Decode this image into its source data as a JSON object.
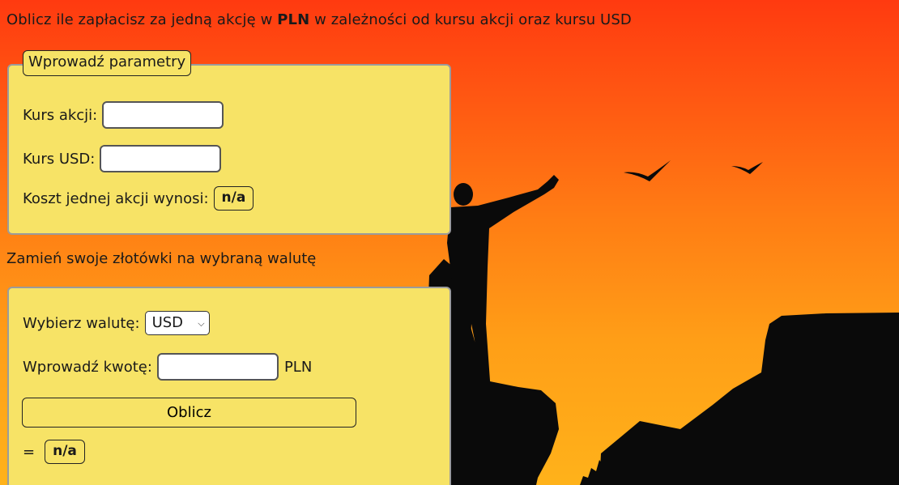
{
  "header": {
    "text_before": "Oblicz ile zapłacisz za jedną akcję w ",
    "text_bold": "PLN",
    "text_after": " w zależności od kursu akcji oraz kursu USD"
  },
  "params_panel": {
    "legend": "Wprowadź parametry",
    "stock_rate_label": "Kurs akcji:",
    "stock_rate_value": "",
    "usd_rate_label": "Kurs USD:",
    "usd_rate_value": "",
    "cost_label": "Koszt jednej akcji wynosi:",
    "cost_value": "n/a"
  },
  "convert_section": {
    "title": "Zamień swoje złotówki na wybraną walutę",
    "currency_label": "Wybierz walutę:",
    "currency_selected": "USD",
    "amount_label": "Wprowadź kwotę:",
    "amount_value": "",
    "amount_unit": "PLN",
    "calculate_button": "Oblicz",
    "equals_sign": "=",
    "result_value": "n/a"
  },
  "colors": {
    "panel_background": "#f7e366",
    "sky_top": "#ff3a10",
    "sky_bottom": "#ffb21a",
    "silhouette": "#0a0a0a"
  },
  "icons": {
    "select_arrow": "chevron-down-icon"
  }
}
